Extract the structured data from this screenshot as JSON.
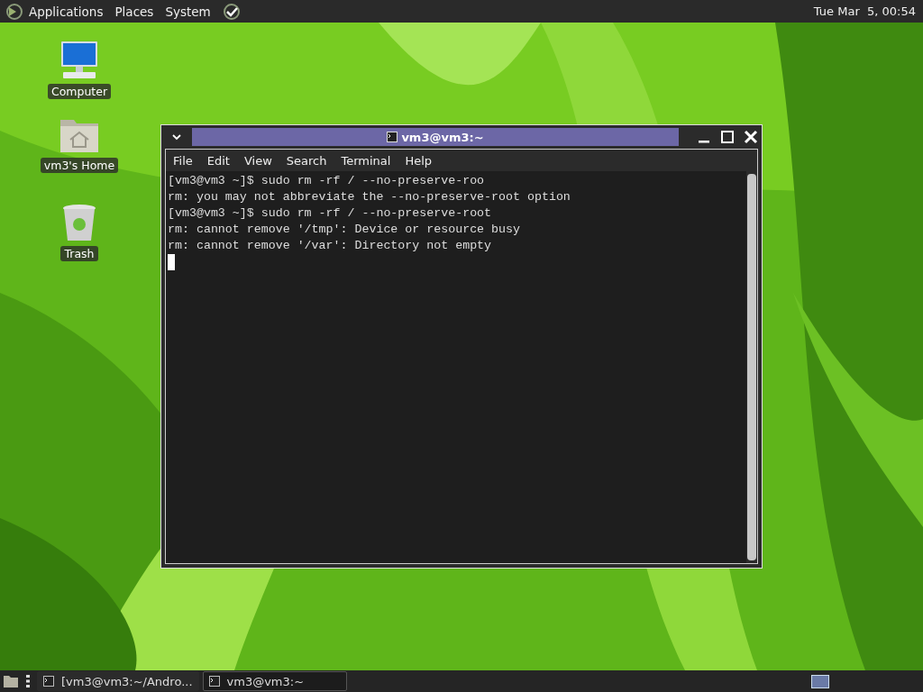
{
  "top_panel": {
    "menus": [
      "Applications",
      "Places",
      "System"
    ],
    "clock": "Tue Mar  5, 00:54"
  },
  "desktop_icons": [
    {
      "kind": "computer",
      "label": "Computer"
    },
    {
      "kind": "home",
      "label": "vm3's Home"
    },
    {
      "kind": "trash",
      "label": "Trash"
    }
  ],
  "terminal": {
    "title": "vm3@vm3:~",
    "menu": [
      "File",
      "Edit",
      "View",
      "Search",
      "Terminal",
      "Help"
    ],
    "lines": [
      "[vm3@vm3 ~]$ sudo rm -rf / --no-preserve-roo",
      "rm: you may not abbreviate the --no-preserve-root option",
      "[vm3@vm3 ~]$ sudo rm -rf / --no-preserve-root",
      "rm: cannot remove '/tmp': Device or resource busy",
      "rm: cannot remove '/var': Directory not empty"
    ]
  },
  "taskbar": {
    "items": [
      {
        "label": "[vm3@vm3:~/Andro...",
        "selected": false
      },
      {
        "label": "vm3@vm3:~",
        "selected": true
      }
    ],
    "workspaces": [
      {
        "selected": true
      }
    ]
  }
}
